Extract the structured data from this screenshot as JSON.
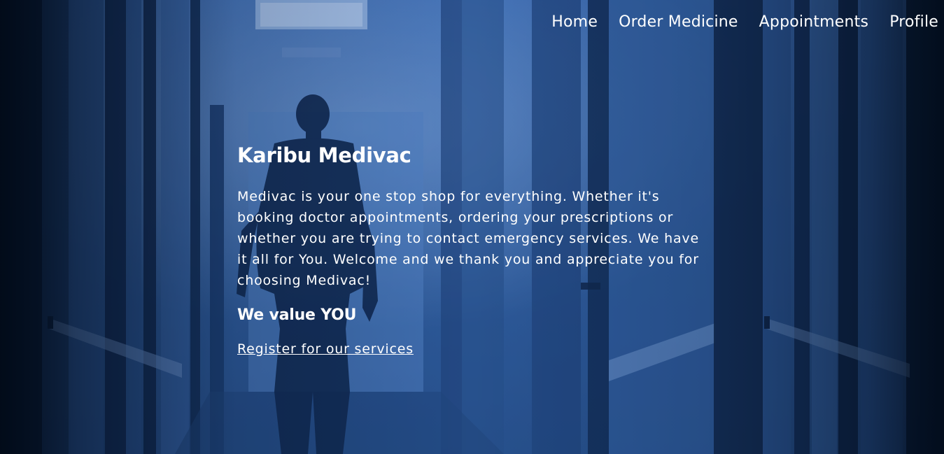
{
  "nav": {
    "items": [
      {
        "label": "Home"
      },
      {
        "label": "Order Medicine"
      },
      {
        "label": "Appointments"
      },
      {
        "label": "Profile"
      }
    ]
  },
  "hero": {
    "title": "Karibu Medivac",
    "intro": "Medivac is your one stop shop for everything. Whether it's booking doctor appointments, ordering your prescriptions or whether you are trying to contact emergency services. We have it all for You. Welcome and we thank you and appreciate you for choosing Medivac!",
    "tagline": "We value YOU",
    "register_link": "Register for our services"
  },
  "colors": {
    "overlay_blue": "#3d6bb0",
    "text": "#ffffff"
  }
}
